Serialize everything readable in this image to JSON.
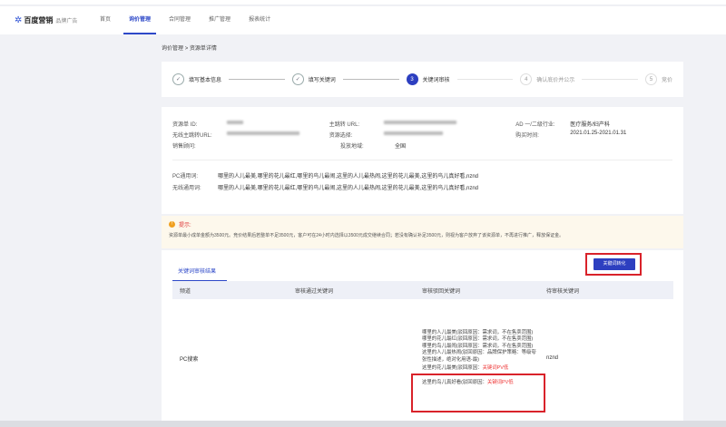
{
  "nav": {
    "brand": "百度营销",
    "brand_sub": "品牌广告",
    "items": [
      "首页",
      "询价管理",
      "合同管理",
      "推广管理",
      "报表统计"
    ],
    "active": 1
  },
  "breadcrumb": {
    "parent": "询价管理",
    "sep": ">",
    "current": "资源单详情"
  },
  "steps": [
    {
      "num": "✓",
      "label": "填写基本信息",
      "state": "done"
    },
    {
      "num": "✓",
      "label": "填写关键词",
      "state": "done"
    },
    {
      "num": "3",
      "label": "关键词审核",
      "state": "current"
    },
    {
      "num": "4",
      "label": "确认底价并公示",
      "state": "todo"
    },
    {
      "num": "5",
      "label": "竞价",
      "state": "todo"
    }
  ],
  "info": {
    "resource_id_label": "资源单 ID:",
    "main_url_label": "主跳转 URL:",
    "industry_label": "AD 一/二级行业:",
    "industry_value": "医疗服务/妇产科",
    "wireless_url_label": "无线主跳转URL:",
    "resource_select_label": "资源选择:",
    "buy_time_label": "购买时间:",
    "buy_time_value": "2021.01.25-2021.01.31",
    "sales_label": "销售顾问:",
    "region_label": "投放地域:",
    "region_value": "全国",
    "pc_kw_label": "PC通用词:",
    "pc_kw_value": "哪里的人儿最美,哪里的花儿最红,哪里的鸟儿最闹,这里的人儿最热闹,这里的花儿最美,这里的鸟儿真好看,nznd",
    "wl_kw_label": "无线通用词:",
    "wl_kw_value": "哪里的人儿最美,哪里的花儿最红,哪里的鸟儿最闹,这里的人儿最热闹,这里的花儿最美,这里的鸟儿真好看,nznd"
  },
  "notice": {
    "title": "提示:",
    "text": "资源单最小成单金额为3500元。竞价结果后若整单不足3500元，客户可在24小时内选择以3500元成交继续合同；若没有确认补足3500元，则视为客户放弃了该资源单，不再进行推广，释放保证金。"
  },
  "result": {
    "tab": "关键词审核结果",
    "button": "关键词转化",
    "headers": [
      "频道",
      "审核通过关键词",
      "审核驳回关键词",
      "待审核关键词"
    ],
    "row": {
      "channel": "PC搜索",
      "pending": "nznd",
      "rejected": [
        {
          "kw": "哪里的人儿最美(驳回原因：",
          "reason": "需求词，不在售卖范围)",
          "red": false
        },
        {
          "kw": "哪里的花儿最红(驳回原因：",
          "reason": "需求词，不在售卖范围)",
          "red": false
        },
        {
          "kw": "哪里的鸟儿最闹(驳回原因：",
          "reason": "需求词，不在售卖范围)",
          "red": false
        },
        {
          "kw": "这里的人儿最热闹(驳回原因：",
          "reason": "品牌保护策略：等级夸张性描述，绝对化用语-最)",
          "red": false
        },
        {
          "kw": "这里的花儿最美(驳回原因：",
          "reason": "关键词PV低",
          "red": true
        },
        {
          "kw": "这里的鸟儿真好看(驳回原因：",
          "reason": "关键词PV低",
          "red": true
        }
      ]
    }
  },
  "colors": {
    "accent": "#2d3fc0",
    "highlight": "#d9222a"
  }
}
